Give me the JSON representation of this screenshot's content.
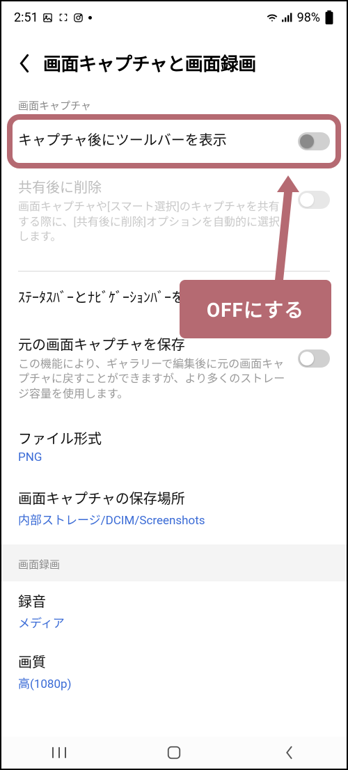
{
  "statusbar": {
    "time": "2:51",
    "battery_pct": "98%"
  },
  "header": {
    "title": "画面キャプチャと画面録画"
  },
  "sections": {
    "capture_label": "画面キャプチャ",
    "toolbar": {
      "title": "キャプチャ後にツールバーを表示"
    },
    "delete_after_share": {
      "title": "共有後に削除",
      "sub": "画面キャプチャや[スマート選択]のキャプチャを共有する際に、[共有後に削除]オプションを自動的に選択します。"
    },
    "hide_bars": {
      "title": "ｽﾃｰﾀｽﾊﾞｰとﾅﾋﾞｹﾞｰｼｮﾝﾊﾞｰを非表示"
    },
    "save_original": {
      "title": "元の画面キャプチャを保存",
      "sub": "この機能により、ギャラリーで編集後に元の画面キャプチャに戻すことができますが、より多くのストレージ容量を使用します。"
    },
    "format": {
      "title": "ファイル形式",
      "value": "PNG"
    },
    "save_location": {
      "title": "画面キャプチャの保存場所",
      "value": "内部ストレージ/DCIM/Screenshots"
    },
    "recording_label": "画面録画",
    "audio": {
      "title": "録音",
      "value": "メディア"
    },
    "quality": {
      "title": "画質",
      "value": "高(1080p)"
    }
  },
  "annotation": {
    "text": "OFFにする"
  },
  "colors": {
    "accent": "#b56a72",
    "link": "#3a6bd6"
  }
}
